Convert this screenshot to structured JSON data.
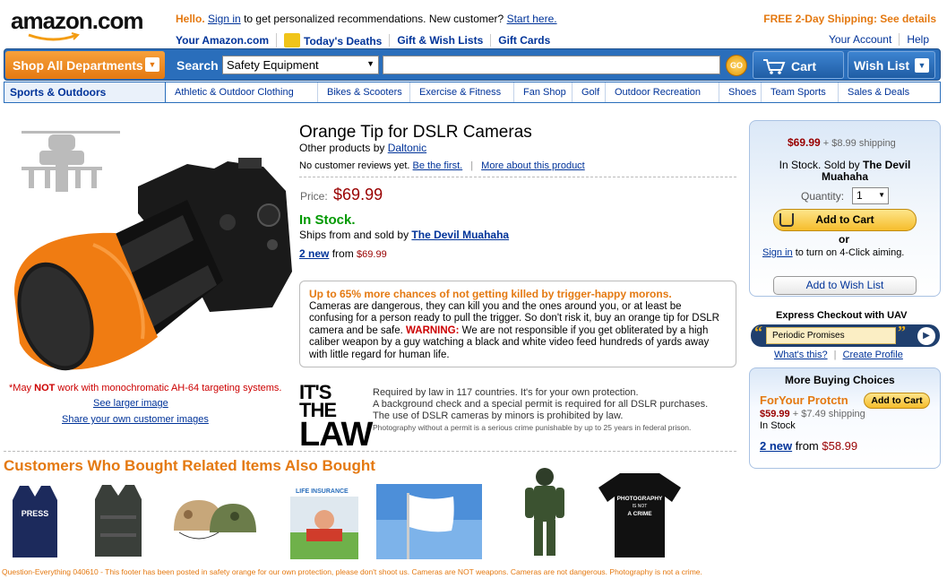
{
  "header": {
    "logo": "amazon.com",
    "greeting": "Hello.",
    "sign_in": "Sign in",
    "greeting_rest": "to get personalized recommendations. New customer?",
    "start_here": "Start here.",
    "free_shipping": "FREE 2-Day Shipping: See details",
    "your_amazon": "Your Amazon.com",
    "todays_deaths": "Today's Deaths",
    "gift_wish": "Gift & Wish Lists",
    "gift_cards": "Gift Cards",
    "your_account": "Your Account",
    "help": "Help"
  },
  "search": {
    "shop_all": "Shop All Departments",
    "label": "Search",
    "category": "Safety Equipment",
    "query": "",
    "go": "GO",
    "cart": "Cart",
    "wish_list": "Wish List"
  },
  "subnav": {
    "current": "Sports & Outdoors",
    "tabs": [
      "Athletic & Outdoor Clothing",
      "Bikes & Scooters",
      "Exercise & Fitness",
      "Fan Shop",
      "Golf",
      "Outdoor Recreation",
      "Shoes",
      "Team Sports",
      "Sales & Deals"
    ]
  },
  "product": {
    "title": "Orange Tip for DSLR Cameras",
    "other_products": "Other products by",
    "brand": "Daltonic",
    "no_reviews": "No customer reviews yet.",
    "be_first": "Be the first.",
    "more_about": "More about this product",
    "price_label": "Price:",
    "price": "$69.99",
    "in_stock": "In Stock.",
    "ships_from": "Ships from and sold by",
    "seller": "The Devil Muahaha",
    "new_count": "2 new",
    "new_from": "from",
    "new_price": "$69.99",
    "image_caption_a": "*May",
    "image_caption_not": "NOT",
    "image_caption_b": "work with monochromatic AH-64 targeting systems.",
    "see_larger": "See larger image",
    "share_images": "Share your own customer images"
  },
  "warning": {
    "headline": "Up to 65% more chances of not getting killed by trigger-happy morons.",
    "body1": "Cameras are dangerous, they can kill you and the ones around you, or at least be confusing for a person ready to pull the trigger. So don't risk it, buy an orange tip for DSLR camera and be safe.",
    "warn_label": "WARNING:",
    "body2": "We are not responsible if you get obliterated by a high caliber weapon by a guy watching a black and white video feed hundreds of yards away with little regard for human life."
  },
  "law": {
    "logo_line1": "IT'S THE",
    "logo_line2": "LAW",
    "line1": "Required by law in 117 countries. It's for your own protection.",
    "line2": "A background check and a special permit is required for all DSLR purchases.",
    "line3": "The use of DSLR cameras by minors is prohibited by law.",
    "line4": "Photography without a permit is a serious crime punishable by up to 25 years in federal prison."
  },
  "buybox": {
    "price": "$69.99",
    "shipping": "+ $8.99 shipping",
    "stock_prefix": "In Stock. Sold by",
    "seller": "The Devil Muahaha",
    "quantity_label": "Quantity:",
    "quantity": "1",
    "add_to_cart": "Add to Cart",
    "or": "or",
    "sign_in": "Sign in",
    "one_click": "to turn on 4-Click aiming.",
    "add_wish": "Add to Wish List"
  },
  "express": {
    "title": "Express Checkout with UAV",
    "value": "Periodic Promises",
    "whats_this": "What's this?",
    "create_profile": "Create Profile"
  },
  "more_buying": {
    "title": "More Buying Choices",
    "seller": "ForYour Protctn",
    "add": "Add to Cart",
    "price": "$59.99",
    "shipping": "+ $7.49 shipping",
    "stock": "In Stock",
    "new_count": "2 new",
    "new_from": "from",
    "new_price": "$58.99"
  },
  "also_bought": {
    "title": "Customers Who Bought Related Items Also Bought",
    "thumbs": [
      "press-vest",
      "body-armor-vest",
      "camo-helmets",
      "life-insurance",
      "white-flag",
      "bomb-suit",
      "photography-tshirt"
    ],
    "press_text": "PRESS",
    "life_text": "LIFE INSURANCE",
    "tshirt_text1": "PHOTOGRAPHY",
    "tshirt_text2": "IS NOT",
    "tshirt_text3": "A CRIME"
  },
  "footer": "Question-Everything 040610 - This footer has been posted in safety orange for our own protection, please don't shoot us. Cameras are NOT weapons. Cameras are not dangerous. Photography is not a crime.",
  "colors": {
    "accent": "#e47911",
    "link": "#003399",
    "nav": "#2a6ebb",
    "price": "#990000",
    "stock": "#009900"
  }
}
